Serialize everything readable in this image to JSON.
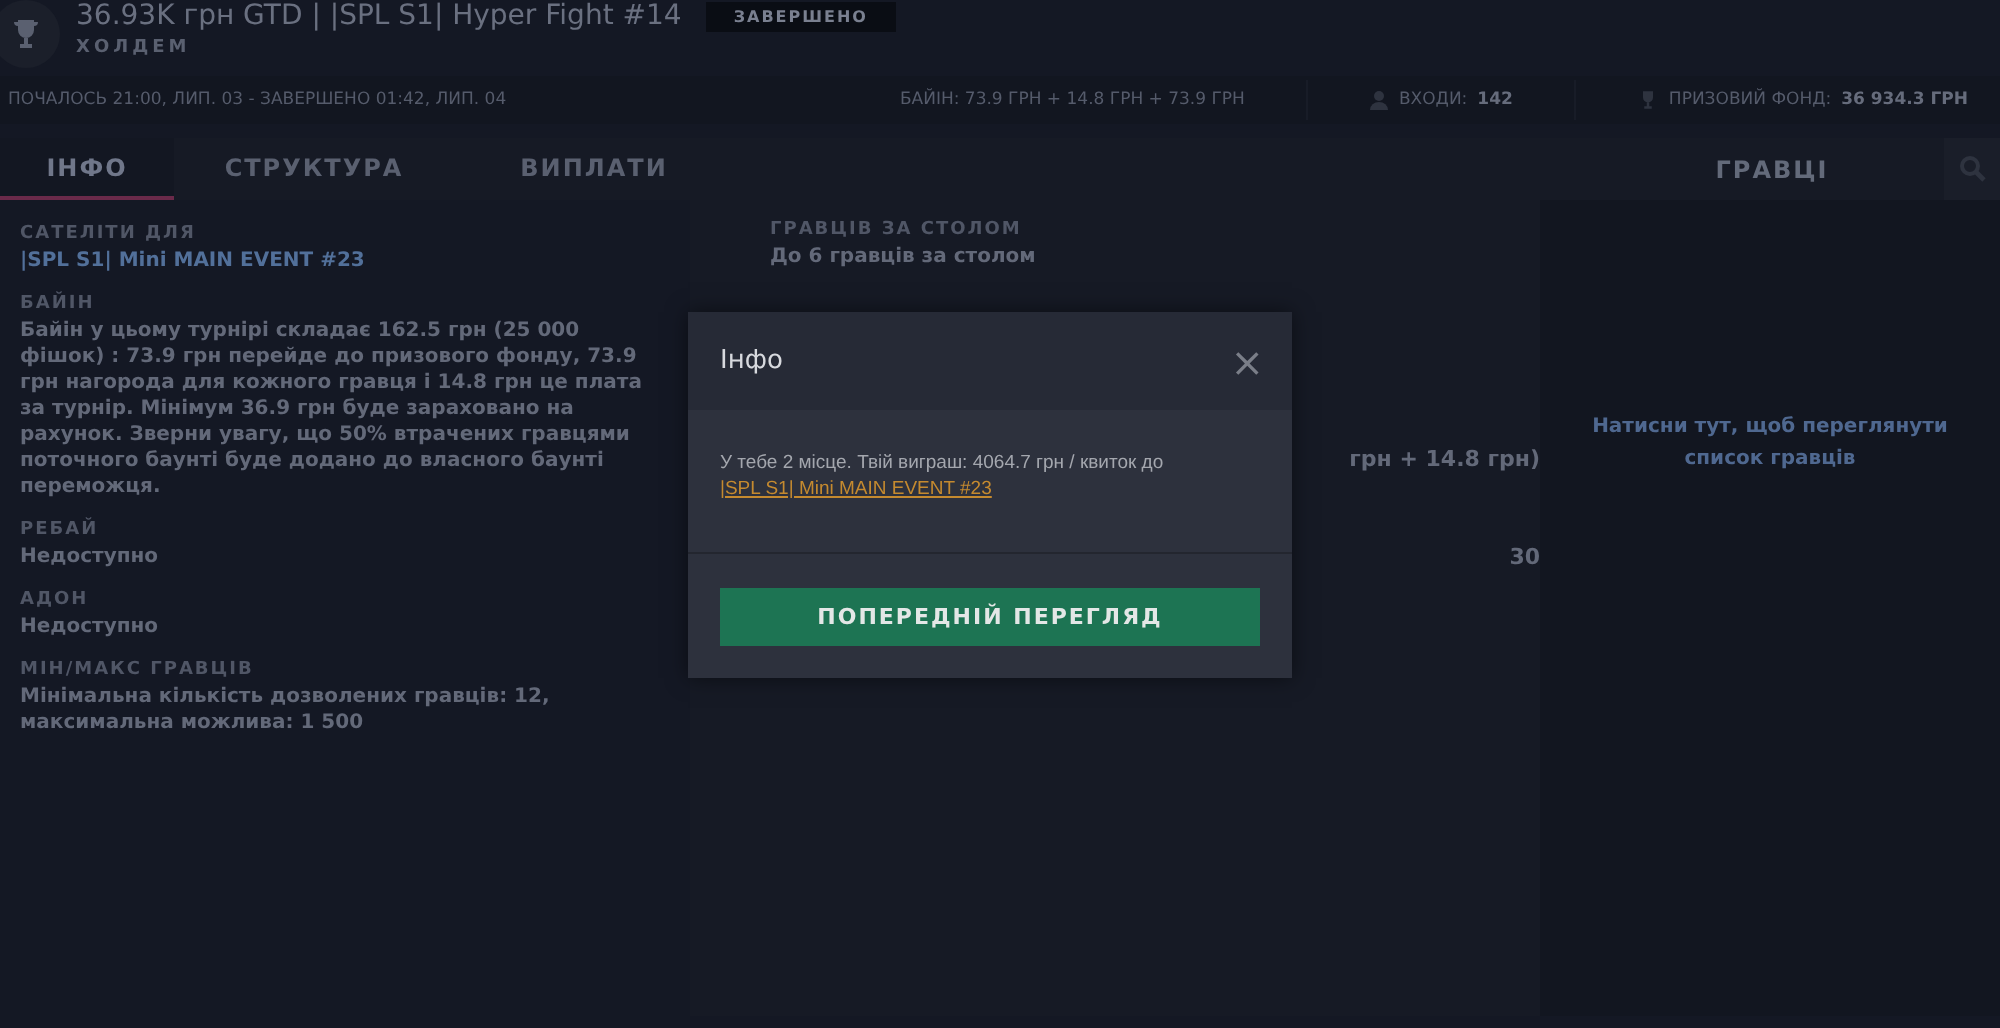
{
  "header": {
    "title": "36.93K грн GTD | |SPL S1| Hyper Fight #14",
    "status": "ЗАВЕРШЕНО",
    "game": "ХОЛДЕМ"
  },
  "info_bar": {
    "time": "ПОЧАЛОСЬ 21:00, ЛИП. 03 - ЗАВЕРШЕНО 01:42, ЛИП. 04",
    "buyin": "БАЙІН: 73.9 ГРН + 14.8 ГРН + 73.9 ГРН",
    "entries_label": "ВХОДИ:",
    "entries": "142",
    "prize_label": "ПРИЗОВИЙ ФОНД:",
    "prize": "36 934.3 ГРН"
  },
  "tabs": [
    {
      "label": "ІНФО",
      "selected": true
    },
    {
      "label": "СТРУКТУРА",
      "selected": false
    },
    {
      "label": "ВИПЛАТИ",
      "selected": false
    }
  ],
  "players_panel": {
    "title": "ГРАВЦІ",
    "hint": "Натисни тут, щоб переглянути список гравців"
  },
  "left_sections": [
    {
      "label": "САТЕЛІТИ ДЛЯ",
      "value": "|SPL S1| Mini MAIN EVENT #23",
      "kind": "link"
    },
    {
      "label": "БАЙІН",
      "value": "Байін у цьому турнірі складає 162.5 грн (25 000 фішок) : 73.9 грн перейде до призового фонду, 73.9 грн нагорода для кожного гравця і 14.8 грн це плата за турнір. Мінімум 36.9 грн буде зараховано на рахунок. Зверни увагу, що 50% втрачених гравцями поточного баунті буде додано до власного баунті переможця.",
      "kind": "text"
    },
    {
      "label": "РЕБАЙ",
      "value": "Недоступно",
      "kind": "text"
    },
    {
      "label": "АДОН",
      "value": "Недоступно",
      "kind": "text"
    },
    {
      "label": "МІН/МАКС ГРАВЦІВ",
      "value": "Мінімальна кількість дозволених гравців: 12, максимальна можлива: 1 500",
      "kind": "text"
    }
  ],
  "middle_sections": [
    {
      "label": "ГРАВЦІВ ЗА СТОЛОМ",
      "value": "До 6 гравців за столом"
    }
  ],
  "middle_fragments": [
    "грн + 14.8 грн)",
    "30"
  ],
  "modal": {
    "title": "Інфо",
    "close": "×",
    "message": "У тебе 2 місце. Твій виграш: 4064.7 грн / квиток до ",
    "link": "|SPL S1| Mini MAIN EVENT #23",
    "button": "ПОПЕРЕДНІЙ ПЕРЕГЛЯД"
  }
}
